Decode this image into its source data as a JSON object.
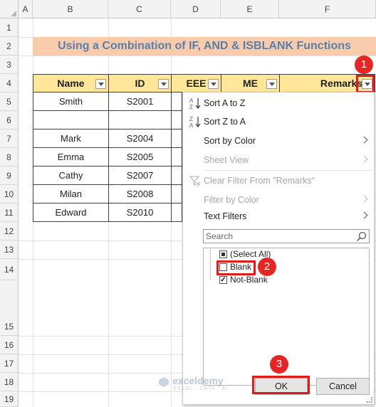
{
  "sheet": {
    "columns": [
      "A",
      "B",
      "C",
      "D",
      "E",
      "F"
    ],
    "rows": [
      "1",
      "2",
      "3",
      "4",
      "5",
      "6",
      "7",
      "8",
      "9",
      "10",
      "11",
      "12",
      "13",
      "14",
      "15",
      "16",
      "17",
      "18",
      "19"
    ],
    "title": "Using a Combination of IF, AND & ISBLANK Functions",
    "headers": [
      "Name",
      "ID",
      "EEE",
      "ME",
      "Remarks"
    ],
    "data": [
      {
        "name": "Smith",
        "id": "S2001"
      },
      {
        "name": "",
        "id": ""
      },
      {
        "name": "Mark",
        "id": "S2004"
      },
      {
        "name": "Emma",
        "id": "S2005"
      },
      {
        "name": "Cathy",
        "id": "S2007"
      },
      {
        "name": "Milan",
        "id": "S2008"
      },
      {
        "name": "Edward",
        "id": "S2010"
      }
    ]
  },
  "menu": {
    "sort_az": "Sort A to Z",
    "sort_za": "Sort Z to A",
    "sort_by_color": "Sort by Color",
    "sheet_view": "Sheet View",
    "clear_filter": "Clear Filter From \"Remarks\"",
    "filter_by_color": "Filter by Color",
    "text_filters": "Text Filters",
    "search_placeholder": "Search",
    "list": [
      {
        "label": "(Select All)",
        "state": "partial"
      },
      {
        "label": "Blank",
        "state": "unchecked"
      },
      {
        "label": "Not-Blank",
        "state": "checked"
      }
    ],
    "ok": "OK",
    "cancel": "Cancel"
  },
  "badges": [
    "1",
    "2",
    "3"
  ],
  "watermark": {
    "name": "exceldemy",
    "tagline": "EXCEL · DATA · BI"
  },
  "colors": {
    "title_bg": "#f8cbad",
    "header_bg": "#ffe699",
    "annotation": "#e01b1b"
  }
}
